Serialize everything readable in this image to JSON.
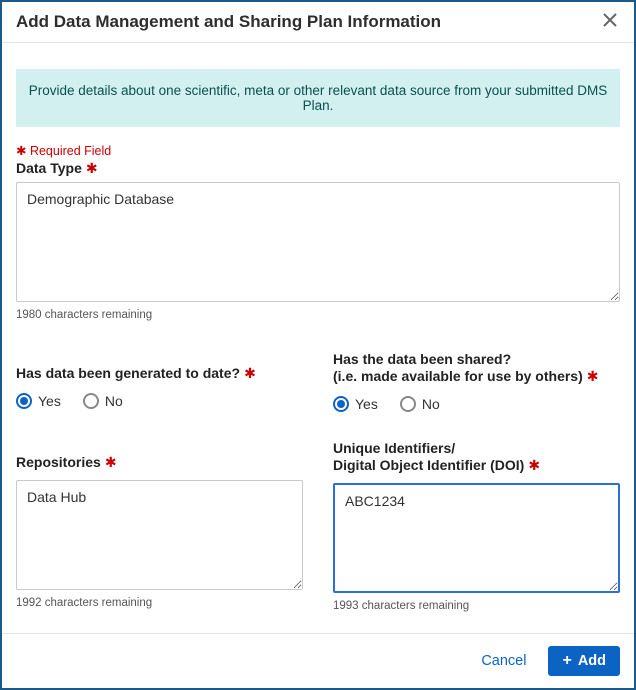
{
  "header": {
    "title": "Add Data Management and Sharing Plan Information"
  },
  "banner": "Provide details about one scientific, meta or other relevant data source from your submitted DMS Plan.",
  "requiredNote": "✱ Required Field",
  "dataType": {
    "label": "Data Type",
    "value": "Demographic Database",
    "remaining": "1980 characters remaining"
  },
  "generated": {
    "label": "Has data been generated to date?",
    "optYes": "Yes",
    "optNo": "No"
  },
  "shared": {
    "labelLine1": "Has the data been shared?",
    "labelLine2": "(i.e. made available for use by others)",
    "optYes": "Yes",
    "optNo": "No"
  },
  "repositories": {
    "label": "Repositories",
    "value": "Data Hub",
    "remaining": "1992 characters remaining"
  },
  "doi": {
    "labelLine1": "Unique Identifiers/",
    "labelLine2": "Digital Object Identifier (DOI)",
    "value": "ABC1234",
    "remaining": "1993 characters remaining"
  },
  "footer": {
    "cancel": "Cancel",
    "add": "Add"
  }
}
